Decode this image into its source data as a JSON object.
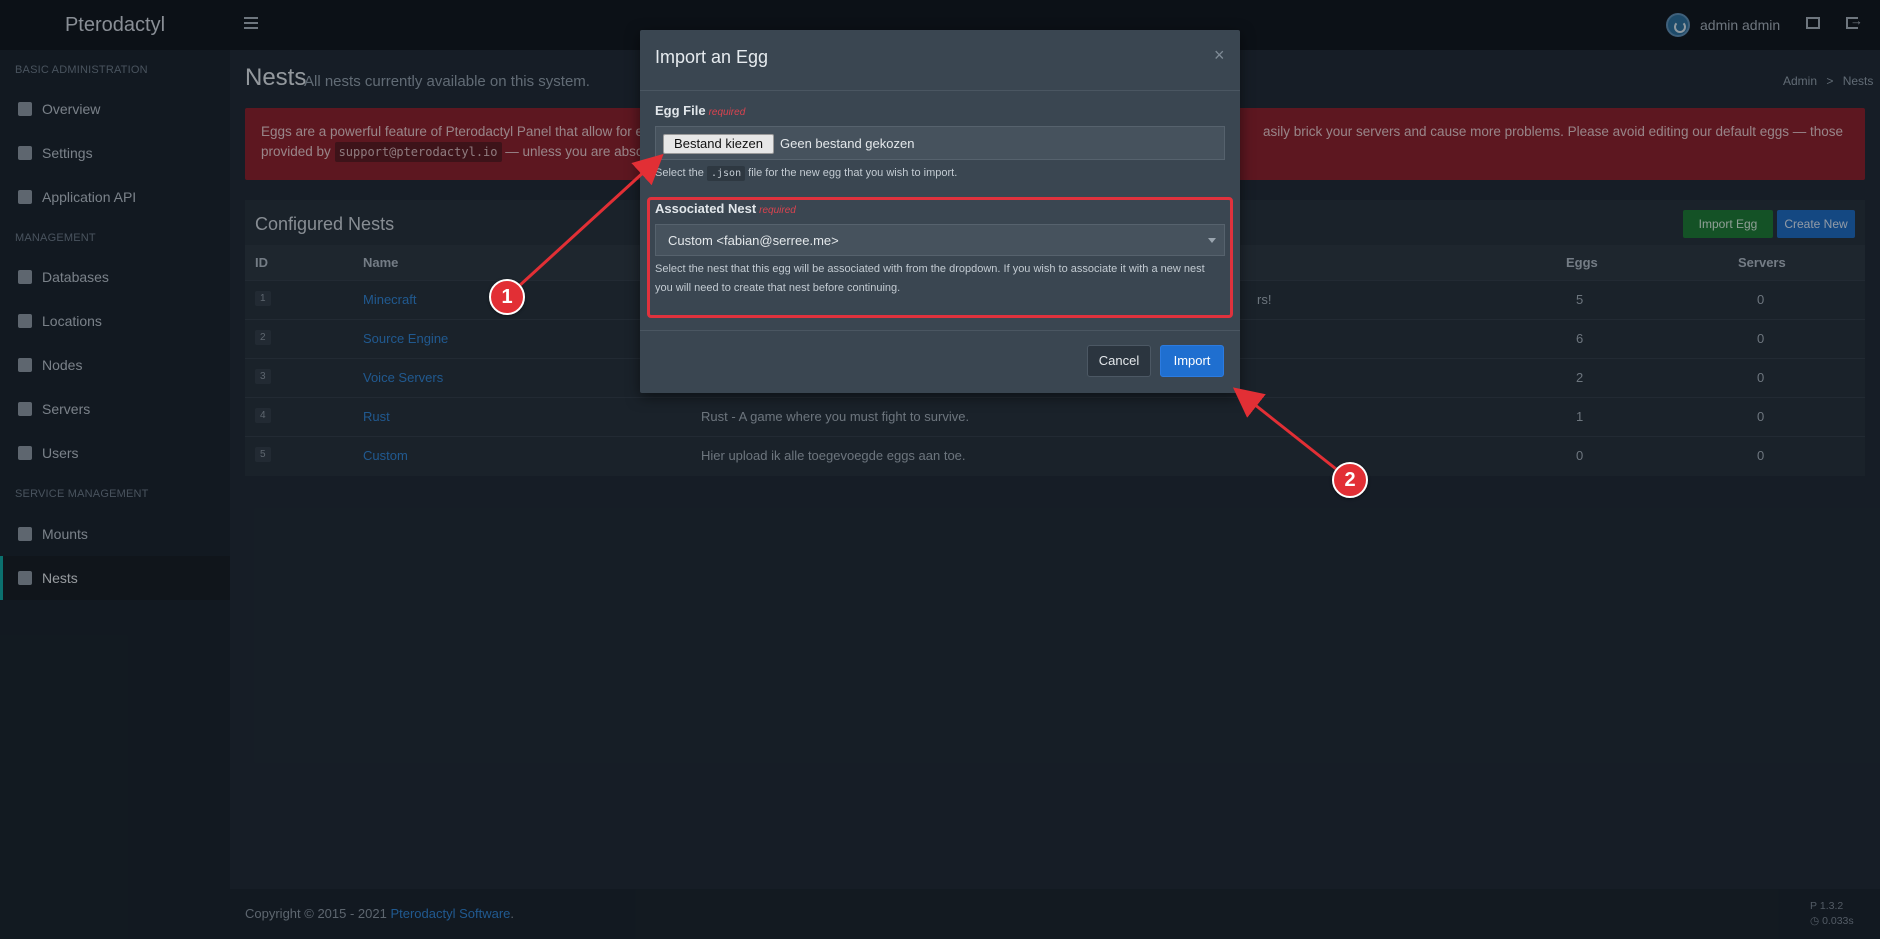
{
  "app": {
    "brand": "Pterodactyl",
    "user_name": "admin admin"
  },
  "sidebar": {
    "sections": [
      {
        "header": "BASIC ADMINISTRATION"
      },
      {
        "header": "MANAGEMENT"
      },
      {
        "header": "SERVICE MANAGEMENT"
      }
    ],
    "items": [
      {
        "label": "Overview",
        "icon": "home-icon"
      },
      {
        "label": "Settings",
        "icon": "wrench-icon"
      },
      {
        "label": "Application API",
        "icon": "gamepad-icon"
      },
      {
        "label": "Databases",
        "icon": "database-icon"
      },
      {
        "label": "Locations",
        "icon": "globe-icon"
      },
      {
        "label": "Nodes",
        "icon": "sitemap-icon"
      },
      {
        "label": "Servers",
        "icon": "server-icon"
      },
      {
        "label": "Users",
        "icon": "users-icon"
      },
      {
        "label": "Mounts",
        "icon": "magic-icon"
      },
      {
        "label": "Nests",
        "icon": "th-large-icon",
        "active": true
      }
    ]
  },
  "page": {
    "title": "Nests",
    "subtitle": "All nests currently available on this system.",
    "breadcrumb": [
      "Admin",
      ">",
      "Nests"
    ]
  },
  "alert": {
    "line1_start": "Eggs are a powerful feature of Pterodactyl Panel that allow for ext",
    "line1_end": "asily brick your servers and cause more problems. Please avoid editing our default eggs — those",
    "line2_start": "provided by",
    "code": "support@pterodactyl.io",
    "line2_end": "— unless you are absolute"
  },
  "nests_box": {
    "title": "Configured Nests",
    "import_button": "Import Egg",
    "create_button": "Create New",
    "columns": [
      "ID",
      "Name",
      "Eggs",
      "Servers"
    ],
    "rows": [
      {
        "id": "1",
        "name": "Minecraft",
        "description": "rs!",
        "eggs": "5",
        "servers": "0"
      },
      {
        "id": "2",
        "name": "Source Engine",
        "description": "",
        "eggs": "6",
        "servers": "0"
      },
      {
        "id": "3",
        "name": "Voice Servers",
        "description": "",
        "eggs": "2",
        "servers": "0"
      },
      {
        "id": "4",
        "name": "Rust",
        "description": "Rust - A game where you must fight to survive.",
        "eggs": "1",
        "servers": "0"
      },
      {
        "id": "5",
        "name": "Custom",
        "description": "Hier upload ik alle toegevoegde eggs aan toe.",
        "eggs": "0",
        "servers": "0"
      }
    ]
  },
  "footer": {
    "copyright": "Copyright © 2015 - 2021",
    "link": "Pterodactyl Software",
    "period": ".",
    "version": "1.3.2",
    "timing": "0.033s"
  },
  "modal": {
    "title": "Import an Egg",
    "close": "×",
    "egg_file_label": "Egg File",
    "required": "required",
    "file_button": "Bestand kiezen",
    "file_status": "Geen bestand gekozen",
    "file_help_pre": "Select the",
    "file_help_code": ".json",
    "file_help_post": "file for the new egg that you wish to import.",
    "nest_label": "Associated Nest",
    "nest_selected": "Custom <fabian@serree.me>",
    "nest_help_line1": "Select the nest that this egg will be associated with from the dropdown. If you wish to associate it with a new nest",
    "nest_help_line2": "you will need to create that nest before continuing.",
    "cancel": "Cancel",
    "import": "Import"
  },
  "annotations": {
    "color": "#e22f35",
    "markers": [
      "1",
      "2"
    ]
  }
}
